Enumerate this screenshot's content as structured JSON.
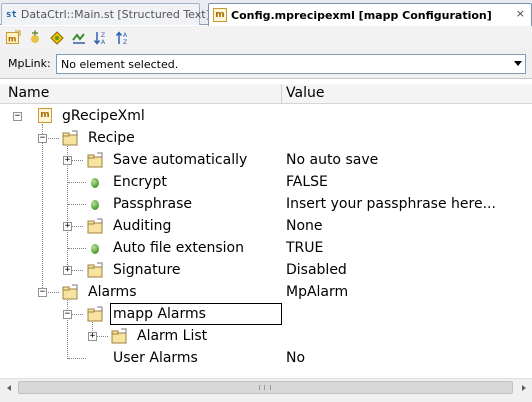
{
  "tabs": [
    {
      "label": "DataCtrl::Main.st [Structured Text]",
      "icon": "st",
      "active": false
    },
    {
      "label": "Config.mprecipexml [mapp Configuration]",
      "icon": "m",
      "active": true,
      "close": "×"
    }
  ],
  "toolbar": {
    "buttons": [
      "mapp-icon",
      "add-icon",
      "diamond-icon",
      "split-icon",
      "sort-descending-icon",
      "sort-ascending-icon"
    ]
  },
  "mplink": {
    "label": "MpLink:",
    "value": "No element selected."
  },
  "columns": {
    "name": "Name",
    "value": "Value"
  },
  "tree": {
    "root": {
      "label": "gRecipeXml",
      "icon": "m"
    },
    "recipe": {
      "label": "Recipe"
    },
    "save_automatically": {
      "label": "Save automatically",
      "value": "No auto save"
    },
    "encrypt": {
      "label": "Encrypt",
      "value": "FALSE"
    },
    "passphrase": {
      "label": "Passphrase",
      "value": "Insert your passphrase here..."
    },
    "auditing": {
      "label": "Auditing",
      "value": "None"
    },
    "auto_file_extension": {
      "label": "Auto file extension",
      "value": "TRUE"
    },
    "signature": {
      "label": "Signature",
      "value": "Disabled"
    },
    "alarms": {
      "label": "Alarms",
      "value": "MpAlarm"
    },
    "mapp_alarms": {
      "label": "mapp Alarms"
    },
    "alarm_list": {
      "label": "Alarm List"
    },
    "user_alarms": {
      "label": "User Alarms",
      "value": "No"
    }
  },
  "expanders": {
    "expanded": "−",
    "collapsed": "+"
  },
  "colors": {
    "accent": "#c99a2e",
    "leaf": "#4c9a2a",
    "tab_border": "#7a90ad"
  }
}
